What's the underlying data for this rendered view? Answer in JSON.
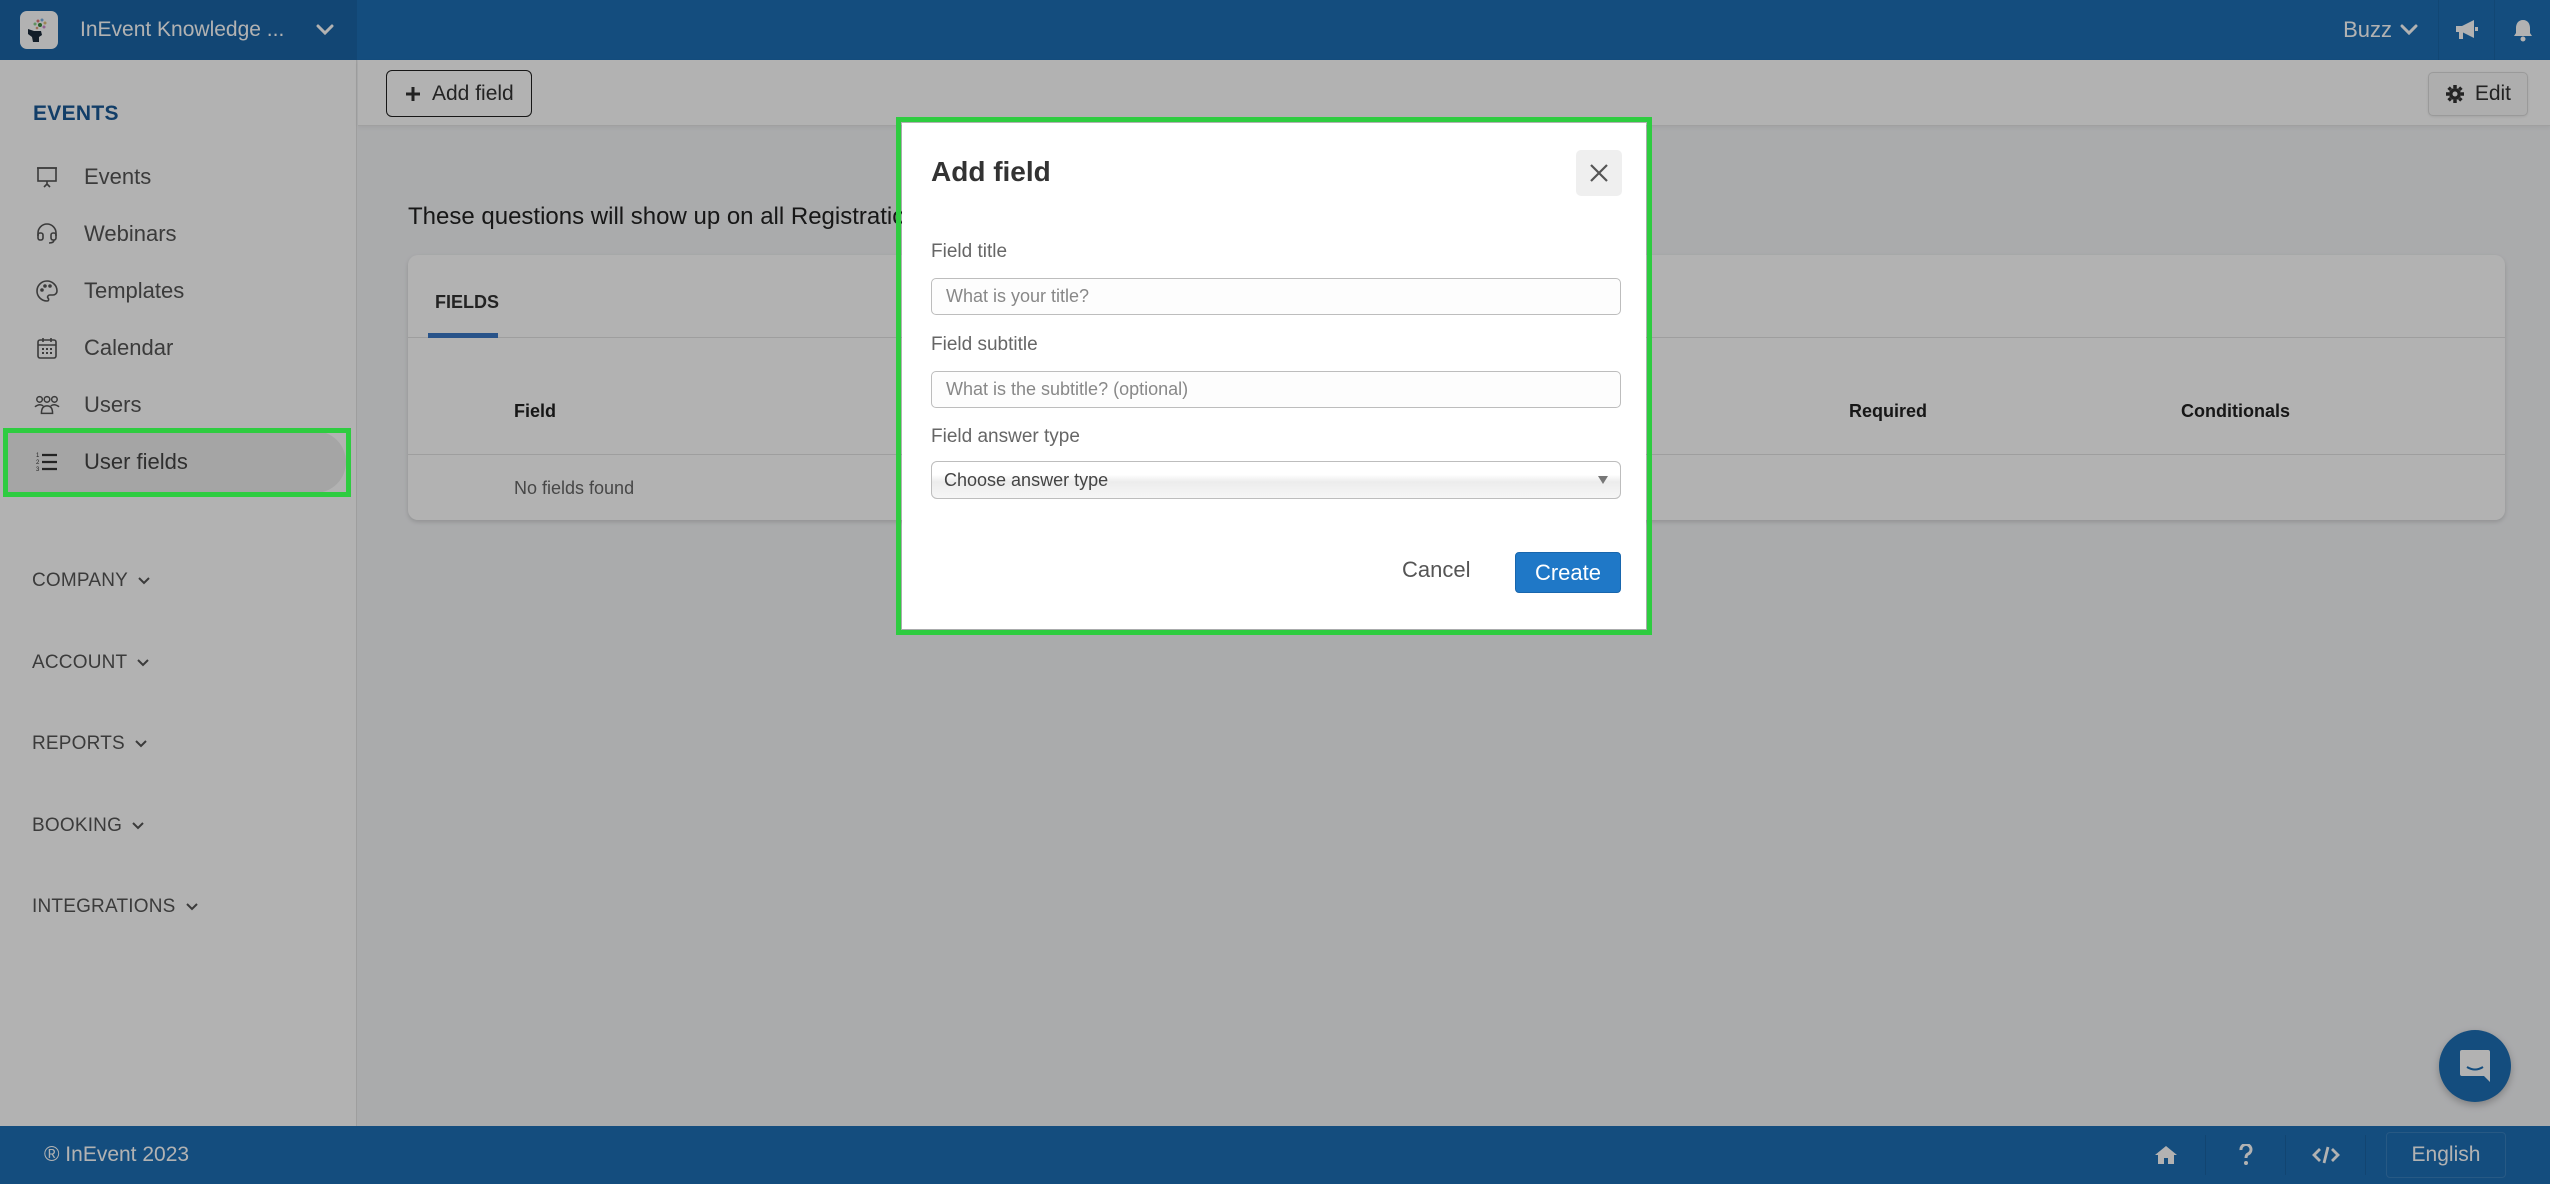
{
  "header": {
    "brand_title": "InEvent Knowledge ...",
    "org_switch_label": "Buzz",
    "icons": [
      "megaphone-icon",
      "bell-icon"
    ]
  },
  "sidebar": {
    "section_title": "EVENTS",
    "items": [
      {
        "label": "Events",
        "icon": "presentation-board-icon"
      },
      {
        "label": "Webinars",
        "icon": "headset-icon"
      },
      {
        "label": "Templates",
        "icon": "palette-icon"
      },
      {
        "label": "Calendar",
        "icon": "calendar-icon"
      },
      {
        "label": "Users",
        "icon": "users-icon"
      },
      {
        "label": "User fields",
        "icon": "numbered-list-icon",
        "active": true
      }
    ],
    "groups": [
      {
        "label": "COMPANY"
      },
      {
        "label": "ACCOUNT"
      },
      {
        "label": "REPORTS"
      },
      {
        "label": "BOOKING"
      },
      {
        "label": "INTEGRATIONS"
      }
    ]
  },
  "toolbar": {
    "add_field_label": "Add field",
    "edit_label": "Edit"
  },
  "main": {
    "intro_text": "These questions will show up on all Registration",
    "tabs": [
      {
        "label": "FIELDS",
        "active": true
      }
    ],
    "table": {
      "columns": [
        "Field",
        "Required",
        "Conditionals"
      ],
      "empty_message": "No fields found"
    }
  },
  "modal": {
    "title": "Add field",
    "fields": {
      "title_label": "Field title",
      "title_placeholder": "What is your title?",
      "title_value": "",
      "subtitle_label": "Field subtitle",
      "subtitle_placeholder": "What is the subtitle? (optional)",
      "subtitle_value": "",
      "answer_type_label": "Field answer type",
      "answer_type_selected": "Choose answer type"
    },
    "cancel_label": "Cancel",
    "create_label": "Create"
  },
  "footer": {
    "copyright": "® InEvent 2023",
    "icons": [
      "home-icon",
      "help-icon",
      "code-icon"
    ],
    "language": "English"
  },
  "colors": {
    "brand_blue": "#1d6fb5",
    "primary_button": "#1f78c7",
    "highlight_green": "#2ecc40",
    "section_title": "#1a5a96"
  }
}
